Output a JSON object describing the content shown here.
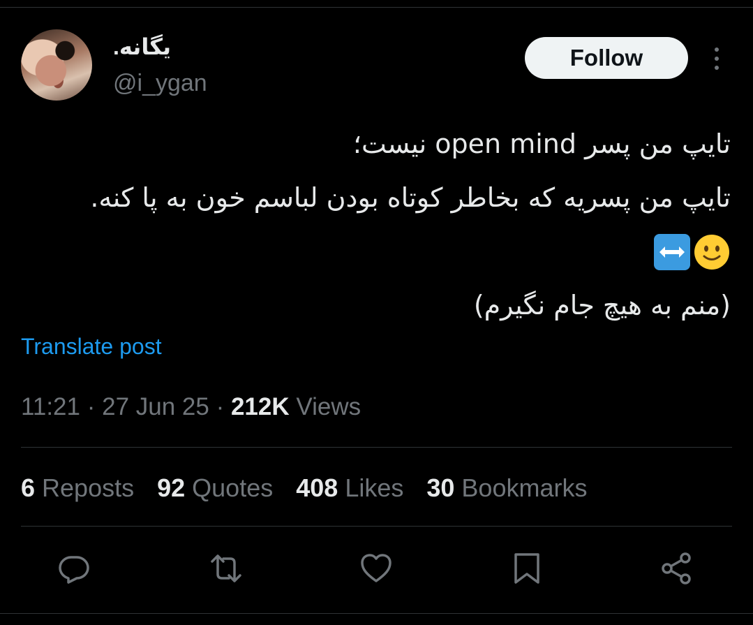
{
  "author": {
    "display_name": "یگانه.",
    "handle": "@i_ygan",
    "avatar_icon": "profile-photo"
  },
  "follow_label": "Follow",
  "tweet": {
    "lines": [
      "تایپ من پسر open mind نیست؛",
      "تایپ من پسریه که بخاطر کوتاه بودن لباسم خون به پا کنه.",
      "(منم به هیچ جام نگیرم)"
    ],
    "emojis": [
      "left-right-arrow-emoji",
      "slightly-smiling-face-emoji"
    ]
  },
  "translate_label": "Translate post",
  "meta": {
    "time": "11:21",
    "sep1": " · ",
    "date": "27 Jun 25",
    "sep2": " · ",
    "views_count": "212K",
    "views_label": " Views"
  },
  "stats": [
    {
      "count": "6",
      "label": "Reposts"
    },
    {
      "count": "92",
      "label": "Quotes"
    },
    {
      "count": "408",
      "label": "Likes"
    },
    {
      "count": "30",
      "label": "Bookmarks"
    }
  ],
  "actions": [
    "reply-icon",
    "repost-icon",
    "like-icon",
    "bookmark-icon",
    "share-icon"
  ],
  "colors": {
    "background": "#000000",
    "text": "#e7e9ea",
    "secondary": "#71767b",
    "link": "#1d9bf0",
    "divider": "#2f3336"
  }
}
